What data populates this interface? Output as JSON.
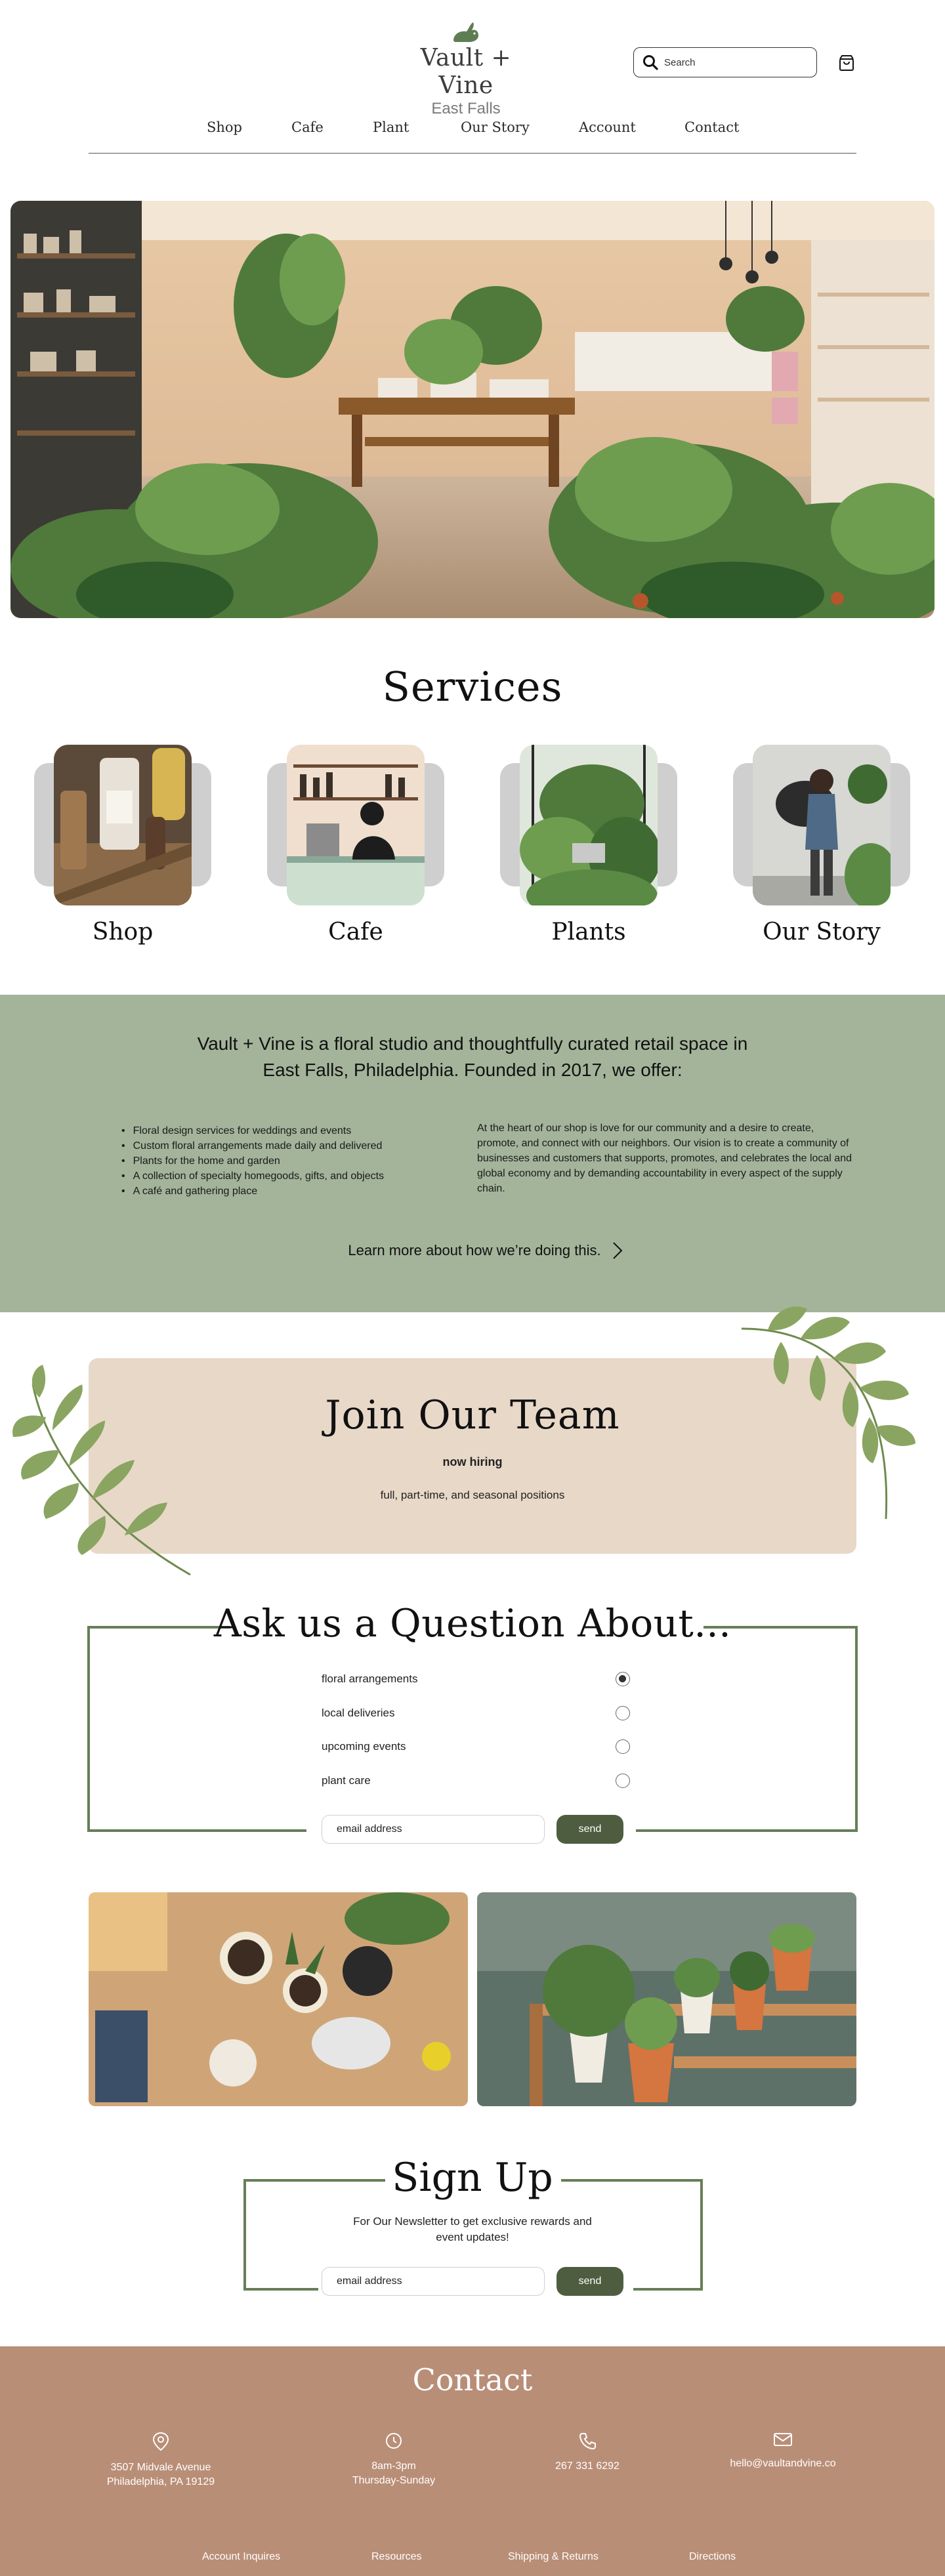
{
  "brand": {
    "name": "Vault + Vine",
    "location": "East Falls",
    "accent": "#677e58",
    "button_color": "#4e5d40"
  },
  "header": {
    "search_placeholder": "Search",
    "nav": [
      "Shop",
      "Cafe",
      "Plant",
      "Our Story",
      "Account",
      "Contact"
    ]
  },
  "services": {
    "title": "Services",
    "items": [
      {
        "label": "Shop",
        "image": "apothecary-bottles"
      },
      {
        "label": "Cafe",
        "image": "barista-counter"
      },
      {
        "label": "Plants",
        "image": "greenhouse-plants"
      },
      {
        "label": "Our Story",
        "image": "owner-with-plant"
      }
    ]
  },
  "about": {
    "background": "#a3b49a",
    "title": "Vault + Vine is a floral studio and thoughtfully curated retail space in East Falls, Philadelphia. Founded in 2017, we offer:",
    "offerings": [
      "Floral design services for weddings and events",
      "Custom floral arrangements made daily and delivered",
      "Plants for the home and garden",
      "A collection of specialty homegoods,  gifts, and objects",
      "A café and gathering place"
    ],
    "mission": "At the heart of our shop is love for our community and a desire to create, promote, and connect with our neighbors. Our vision is to create a community of businesses and customers that supports, promotes, and celebrates the local and global economy and by demanding accountability in every aspect of the supply chain.",
    "link": "Learn more about how we’re doing this."
  },
  "join": {
    "title": "Join Our Team",
    "status": "now hiring",
    "positions": "full, part-time, and seasonal positions",
    "background": "#e8d8c8"
  },
  "question": {
    "title": "Ask us a Question About...",
    "options": [
      {
        "label": "floral arrangements",
        "selected": true
      },
      {
        "label": "local deliveries",
        "selected": false
      },
      {
        "label": "upcoming events",
        "selected": false
      },
      {
        "label": "plant care",
        "selected": false
      }
    ],
    "email_placeholder": "email address",
    "send": "send"
  },
  "signup": {
    "title": "Sign Up",
    "text": "For Our Newsletter to get exclusive rewards and event updates!",
    "email_placeholder": "email address",
    "send": "send"
  },
  "footer": {
    "background": "#b98e77",
    "title": "Contact",
    "address": "3507 Midvale Avenue\nPhiladelphia, PA 19129",
    "hours": "8am-3pm\nThursday-Sunday",
    "phone": "267 331 6292",
    "email": "hello@vaultandvine.co",
    "links": [
      "Account Inquires",
      "Resources",
      "Shipping & Returns",
      "Directions"
    ]
  }
}
